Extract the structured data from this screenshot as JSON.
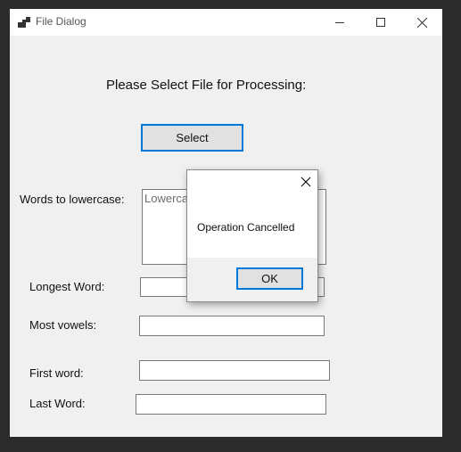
{
  "window": {
    "title": "File Dialog",
    "minimize_icon": "minimize-icon",
    "maximize_icon": "maximize-icon",
    "close_icon": "close-icon"
  },
  "form": {
    "heading": "Please Select File for Processing:",
    "select_button": "Select",
    "words_lowercase_label": "Words to lowercase:",
    "words_lowercase_value": "Lowercase words",
    "longest_word_label": "Longest Word:",
    "longest_word_value": "",
    "most_vowels_label": "Most vowels:",
    "most_vowels_value": "",
    "first_word_label": "First word:",
    "first_word_value": "",
    "last_word_label": "Last Word:",
    "last_word_value": ""
  },
  "message_box": {
    "text": "Operation Cancelled",
    "ok_button": "OK",
    "close_icon": "close-icon"
  },
  "colors": {
    "accent": "#0078d7",
    "window_bg": "#f0f0f0",
    "backdrop": "#2b2b2b"
  }
}
